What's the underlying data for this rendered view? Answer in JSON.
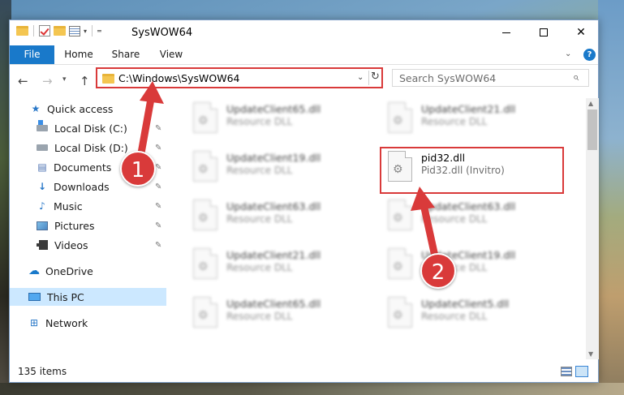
{
  "window": {
    "title": "SysWOW64"
  },
  "ribbon": {
    "tabs": [
      "File",
      "Home",
      "Share",
      "View"
    ]
  },
  "address": {
    "path": "C:\\Windows\\SysWOW64"
  },
  "search": {
    "placeholder": "Search SysWOW64"
  },
  "nav": {
    "items": [
      {
        "label": "Quick access",
        "icon": "star-icon"
      },
      {
        "label": "Local Disk (C:)",
        "icon": "drive-icon"
      },
      {
        "label": "Local Disk (D:)",
        "icon": "drive-icon"
      },
      {
        "label": "Documents",
        "icon": "documents-icon"
      },
      {
        "label": "Downloads",
        "icon": "download-icon"
      },
      {
        "label": "Music",
        "icon": "music-icon"
      },
      {
        "label": "Pictures",
        "icon": "pictures-icon"
      },
      {
        "label": "Videos",
        "icon": "videos-icon"
      },
      {
        "label": "OneDrive",
        "icon": "cloud-icon"
      },
      {
        "label": "This PC",
        "icon": "computer-icon"
      },
      {
        "label": "Network",
        "icon": "network-icon"
      }
    ]
  },
  "files": {
    "left": [
      {
        "name": "UpdateClient65.dll",
        "desc": "Resource DLL"
      },
      {
        "name": "UpdateClient19.dll",
        "desc": "Resource DLL"
      },
      {
        "name": "UpdateClient63.dll",
        "desc": "Resource DLL"
      },
      {
        "name": "UpdateClient21.dll",
        "desc": "Resource DLL"
      },
      {
        "name": "UpdateClient65.dll",
        "desc": "Resource DLL"
      }
    ],
    "right": [
      {
        "name": "UpdateClient21.dll",
        "desc": "Resource DLL"
      },
      {
        "name": "pid32.dll",
        "desc": "Pid32.dll (Invitro)"
      },
      {
        "name": "UpdateClient63.dll",
        "desc": "Resource DLL"
      },
      {
        "name": "UpdateClient19.dll",
        "desc": "Resource DLL"
      },
      {
        "name": "UpdateClient5.dll",
        "desc": "Resource DLL"
      }
    ]
  },
  "status": {
    "item_count": "135 items"
  },
  "annotations": {
    "step1": "1",
    "step2": "2",
    "color": "#d93a3a"
  }
}
